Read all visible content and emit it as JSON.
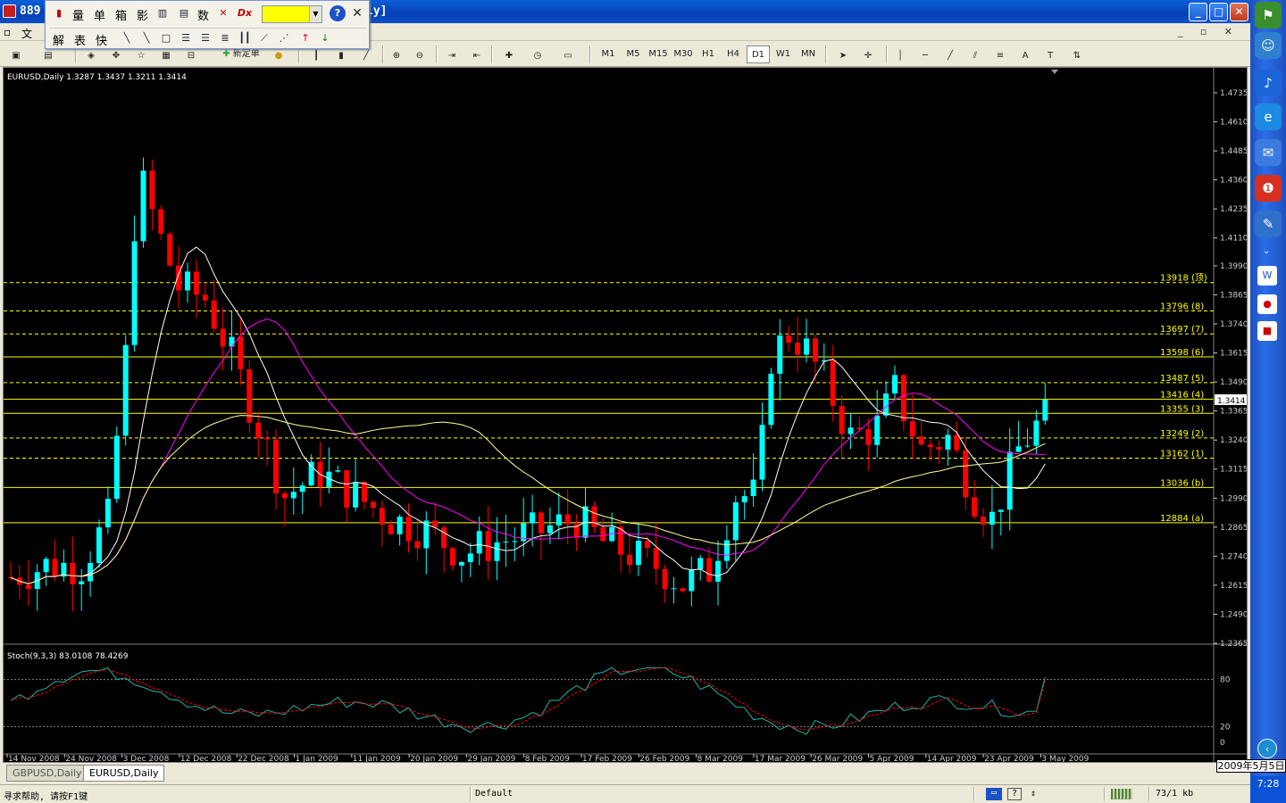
{
  "window": {
    "title_fragment": "889",
    "title_suffix": "ly]"
  },
  "menu": [
    "文"
  ],
  "floating_toolbar": {
    "row1": [
      "量",
      "单",
      "箱",
      "影",
      "数"
    ],
    "row2": [
      "解",
      "表",
      "快"
    ],
    "color_value": "yellow"
  },
  "toolbar": {
    "new_order": "新定单",
    "timeframes": [
      "M1",
      "M5",
      "M15",
      "M30",
      "H1",
      "H4",
      "D1",
      "W1",
      "MN"
    ]
  },
  "chart": {
    "header": "EURUSD,Daily  1.3287 1.3437 1.3211 1.3414",
    "price_axis": [
      "1.4735",
      "1.4610",
      "1.4485",
      "1.4360",
      "1.4235",
      "1.4110",
      "1.3990",
      "1.3865",
      "1.3740",
      "1.3615",
      "1.3490",
      "1.3365",
      "1.3240",
      "1.3115",
      "1.2990",
      "1.2865",
      "1.2740",
      "1.2615",
      "1.2490",
      "1.2365"
    ],
    "current_price": "1.3414",
    "fib_levels": [
      {
        "label": "13918 (顶)",
        "price": 1.3918,
        "dashed": true
      },
      {
        "label": "13796 (8)",
        "price": 1.3796,
        "dashed": true
      },
      {
        "label": "13697 (7)",
        "price": 1.3697,
        "dashed": true
      },
      {
        "label": "13598 (6)",
        "price": 1.3598,
        "dashed": false
      },
      {
        "label": "13487 (5)",
        "price": 1.3487,
        "dashed": true
      },
      {
        "label": "13416 (4)",
        "price": 1.3416,
        "dashed": false
      },
      {
        "label": "13355 (3)",
        "price": 1.3355,
        "dashed": false
      },
      {
        "label": "13249 (2)",
        "price": 1.3249,
        "dashed": true
      },
      {
        "label": "13162 (1)",
        "price": 1.3162,
        "dashed": true
      },
      {
        "label": "13036 (b)",
        "price": 1.3036,
        "dashed": false
      },
      {
        "label": "12884 (a)",
        "price": 1.2884,
        "dashed": false
      }
    ],
    "date_axis": [
      "14 Nov 2008",
      "24 Nov 2008",
      "3 Dec 2008",
      "12 Dec 2008",
      "22 Dec 2008",
      "1 Jan 2009",
      "11 Jan 2009",
      "20 Jan 2009",
      "29 Jan 2009",
      "8 Feb 2009",
      "17 Feb 2009",
      "26 Feb 2009",
      "8 Mar 2009",
      "17 Mar 2009",
      "26 Mar 2009",
      "5 Apr 2009",
      "14 Apr 2009",
      "23 Apr 2009",
      "3 May 2009"
    ],
    "stoch_header": "Stoch(9,3,3) 83.0108 78.4269",
    "stoch_axis": [
      "80",
      "20",
      "0"
    ],
    "colors": {
      "bull": "#00ffff",
      "bear": "#ff0000",
      "fib": "#ffff00",
      "ma_fast": "#ffffff",
      "ma_mid": "#ff00ff",
      "ma_slow": "#ffff99",
      "stoch_main": "#20b2aa",
      "stoch_signal": "#ff0000"
    }
  },
  "chart_data": {
    "type": "candlestick",
    "symbol": "EURUSD",
    "timeframe": "Daily",
    "ylim": [
      1.2365,
      1.4735
    ],
    "last_bar": {
      "open": 1.3287,
      "high": 1.3437,
      "low": 1.3211,
      "close": 1.3414
    },
    "stoch": {
      "k": 83.0108,
      "d": 78.4269,
      "levels": [
        80,
        20
      ]
    }
  },
  "tabs": [
    "GBPUSD,Daily",
    "EURUSD,Daily"
  ],
  "datebox": "2009年5月5日",
  "status": {
    "help": "寻求帮助, 请按F1键",
    "profile": "Default",
    "traffic": "73/1 kb"
  },
  "clock": "7:28"
}
